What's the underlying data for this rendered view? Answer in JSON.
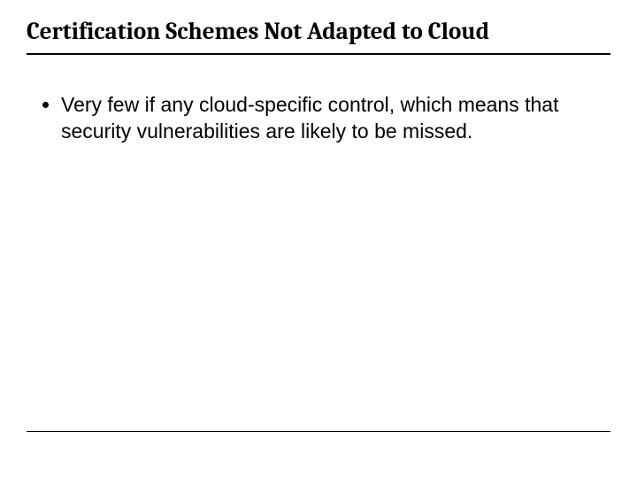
{
  "slide": {
    "title": "Certification Schemes Not Adapted to Cloud",
    "bullets": [
      "Very few if any cloud-specific control, which means that security vulnerabilities are likely to be missed."
    ]
  }
}
